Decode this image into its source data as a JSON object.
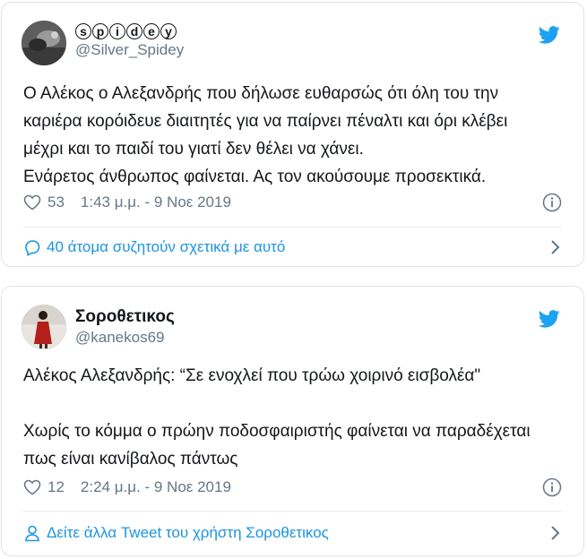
{
  "colors": {
    "brand": "#1da1f2",
    "link": "#1b95e0",
    "muted": "#657786",
    "text": "#14171a"
  },
  "tweets": [
    {
      "display_name_letters": [
        "s",
        "p",
        "i",
        "d",
        "e",
        "y"
      ],
      "handle": "@Silver_Spidey",
      "text": "Ο Αλέκος ο Αλεξανδρής που δήλωσε ευθαρσώς ότι όλη του την\nκαριέρα κορόιδευε διαιτητές για να παίρνει πέναλτι και όρι κλέβει\nμέχρι και το παιδί του γιατί δεν θέλει να χάνει.\nΕνάρετος άνθρωπος φαίνεται. Ας τον ακούσουμε προσεκτικά.",
      "likes": "53",
      "timestamp": "1:43 μ.μ. - 9 Νοε 2019",
      "footer_label": "40 άτομα συζητούν σχετικά με αυτό",
      "footer_icon": "comment-icon"
    },
    {
      "display_name": "Σοροθετικος",
      "handle": "@kanekos69",
      "text": "Αλέκος Αλεξανδρής: “Σε ενοχλεί που τρώω χοιρινό εισβολέα\"\n\nΧωρίς το κόμμα ο πρώην ποδοσφαιριστής φαίνεται να παραδέχεται\nπως είναι κανίβαλος πάντως",
      "likes": "12",
      "timestamp": "2:24 μ.μ. - 9 Νοε 2019",
      "footer_label": "Δείτε άλλα Tweet του χρήστη Σοροθετικος",
      "footer_icon": "user-icon"
    }
  ]
}
